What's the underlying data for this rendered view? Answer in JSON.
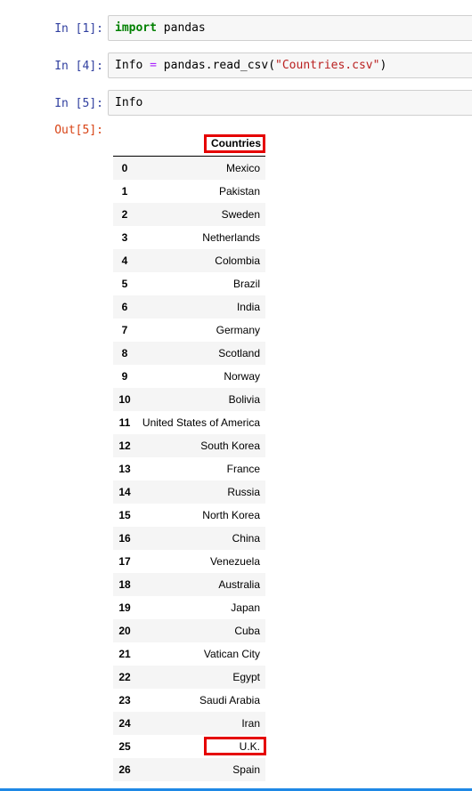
{
  "cells": [
    {
      "prompt": "In [1]:",
      "code": {
        "keyword": "import",
        "rest": " pandas"
      }
    },
    {
      "prompt": "In [4]:",
      "code": {
        "var": "Info",
        "op": " = ",
        "call": "pandas.read_csv(",
        "str": "\"Countries.csv\"",
        "close": ")"
      }
    },
    {
      "prompt": "In [5]:",
      "code": {
        "text": "Info"
      }
    }
  ],
  "output": {
    "prompt": "Out[5]:",
    "column_header": "Countries",
    "rows": [
      {
        "index": "0",
        "value": "Mexico"
      },
      {
        "index": "1",
        "value": "Pakistan"
      },
      {
        "index": "2",
        "value": "Sweden"
      },
      {
        "index": "3",
        "value": "Netherlands"
      },
      {
        "index": "4",
        "value": "Colombia"
      },
      {
        "index": "5",
        "value": "Brazil"
      },
      {
        "index": "6",
        "value": "India"
      },
      {
        "index": "7",
        "value": "Germany"
      },
      {
        "index": "8",
        "value": "Scotland"
      },
      {
        "index": "9",
        "value": "Norway"
      },
      {
        "index": "10",
        "value": "Bolivia"
      },
      {
        "index": "11",
        "value": "United States of America"
      },
      {
        "index": "12",
        "value": "South Korea"
      },
      {
        "index": "13",
        "value": "France"
      },
      {
        "index": "14",
        "value": "Russia"
      },
      {
        "index": "15",
        "value": "North Korea"
      },
      {
        "index": "16",
        "value": "China"
      },
      {
        "index": "17",
        "value": "Venezuela"
      },
      {
        "index": "18",
        "value": "Australia"
      },
      {
        "index": "19",
        "value": "Japan"
      },
      {
        "index": "20",
        "value": "Cuba"
      },
      {
        "index": "21",
        "value": "Vatican City"
      },
      {
        "index": "22",
        "value": "Egypt"
      },
      {
        "index": "23",
        "value": "Saudi Arabia"
      },
      {
        "index": "24",
        "value": "Iran"
      },
      {
        "index": "25",
        "value": "U.K."
      },
      {
        "index": "26",
        "value": "Spain"
      }
    ]
  },
  "colors": {
    "in_prompt": "#303f9f",
    "out_prompt": "#d84315",
    "highlight": "#e50000",
    "keyword": "#008000",
    "string": "#ba2121",
    "operator": "#aa22ff"
  }
}
